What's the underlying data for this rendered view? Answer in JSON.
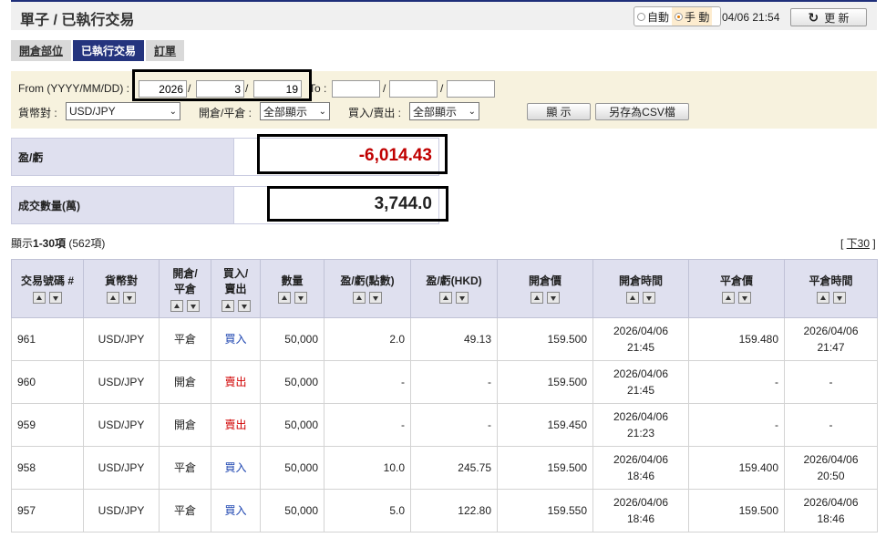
{
  "header": {
    "title": "單子 / 已執行交易",
    "mode_auto": "自動",
    "mode_manual": "手 動",
    "datetime": "04/06 21:54",
    "refresh_label": "更 新"
  },
  "tabs": [
    {
      "label": "開倉部位",
      "active": false
    },
    {
      "label": "已執行交易",
      "active": true
    },
    {
      "label": "訂單",
      "active": false
    }
  ],
  "filters": {
    "from_label": "From (YYYY/MM/DD) :",
    "from_year": "2026",
    "from_month": "3",
    "from_day": "19",
    "to_label": "To :",
    "to_year": "",
    "to_month": "",
    "to_day": "",
    "date_sep": "/",
    "pair_label": "貨幣對 :",
    "pair_value": "USD/JPY",
    "openclose_label": "開倉/平倉 :",
    "openclose_value": "全部顯示",
    "buysell_label": "買入/賣出 :",
    "buysell_value": "全部顯示",
    "show_button": "顯 示",
    "csv_button": "另存為CSV檔"
  },
  "summary": {
    "pnl_label": "盈/虧",
    "pnl_value": "-6,014.43",
    "volume_label": "成交數量(萬)",
    "volume_value": "3,744.0"
  },
  "pagination": {
    "prefix": "顯示",
    "range": "1-30項",
    "total": " (562項)",
    "next_open": "[ ",
    "next_label": "下30",
    "next_close": " ]"
  },
  "table": {
    "headers": [
      {
        "l1": "交易號碼 #",
        "l2": ""
      },
      {
        "l1": "貨幣對",
        "l2": ""
      },
      {
        "l1": "開倉/",
        "l2": "平倉"
      },
      {
        "l1": "買入/",
        "l2": "賣出"
      },
      {
        "l1": "數量",
        "l2": ""
      },
      {
        "l1": "盈/虧(點數)",
        "l2": ""
      },
      {
        "l1": "盈/虧(HKD)",
        "l2": ""
      },
      {
        "l1": "開倉價",
        "l2": ""
      },
      {
        "l1": "開倉時間",
        "l2": ""
      },
      {
        "l1": "平倉價",
        "l2": ""
      },
      {
        "l1": "平倉時間",
        "l2": ""
      }
    ],
    "rows": [
      {
        "id": "961",
        "pair": "USD/JPY",
        "oc": "平倉",
        "bs": "買入",
        "side": "buy",
        "qty": "50,000",
        "pips": "2.0",
        "hkd": "49.13",
        "open_price": "159.500",
        "open_date": "2026/04/06",
        "open_time": "21:45",
        "close_price": "159.480",
        "close_date": "2026/04/06",
        "close_time": "21:47"
      },
      {
        "id": "960",
        "pair": "USD/JPY",
        "oc": "開倉",
        "bs": "賣出",
        "side": "sell",
        "qty": "50,000",
        "pips": "-",
        "hkd": "-",
        "open_price": "159.500",
        "open_date": "2026/04/06",
        "open_time": "21:45",
        "close_price": "-",
        "close_date": "-",
        "close_time": ""
      },
      {
        "id": "959",
        "pair": "USD/JPY",
        "oc": "開倉",
        "bs": "賣出",
        "side": "sell",
        "qty": "50,000",
        "pips": "-",
        "hkd": "-",
        "open_price": "159.450",
        "open_date": "2026/04/06",
        "open_time": "21:23",
        "close_price": "-",
        "close_date": "-",
        "close_time": ""
      },
      {
        "id": "958",
        "pair": "USD/JPY",
        "oc": "平倉",
        "bs": "買入",
        "side": "buy",
        "qty": "50,000",
        "pips": "10.0",
        "hkd": "245.75",
        "open_price": "159.500",
        "open_date": "2026/04/06",
        "open_time": "18:46",
        "close_price": "159.400",
        "close_date": "2026/04/06",
        "close_time": "20:50"
      },
      {
        "id": "957",
        "pair": "USD/JPY",
        "oc": "平倉",
        "bs": "買入",
        "side": "buy",
        "qty": "50,000",
        "pips": "5.0",
        "hkd": "122.80",
        "open_price": "159.550",
        "open_date": "2026/04/06",
        "open_time": "18:46",
        "close_price": "159.500",
        "close_date": "2026/04/06",
        "close_time": "18:46"
      }
    ]
  },
  "colors": {
    "nav_active": "#24347e",
    "header_bg": "#dfe0ef",
    "filter_bg": "#f7f2de",
    "negative": "#c00000",
    "buy": "#1c44b0",
    "sell": "#d00000"
  }
}
